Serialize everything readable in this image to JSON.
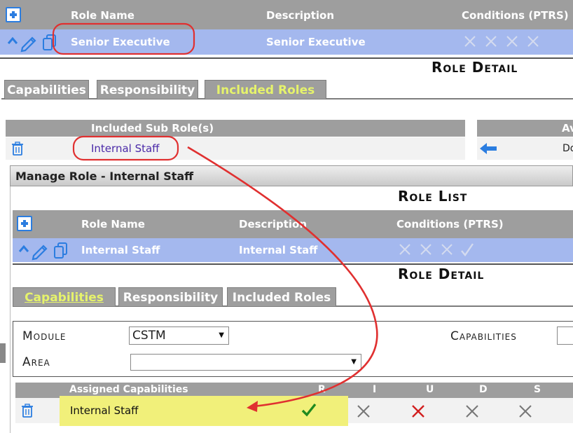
{
  "outer": {
    "role_list_header": {
      "role_name": "Role Name",
      "description": "Description",
      "conditions": "Conditions (PTRS)"
    },
    "role_row": {
      "role_name": "Senior Executive",
      "description": "Senior Executive"
    },
    "role_detail_title": "Role Detail",
    "tabs": [
      {
        "label": "Capabilities"
      },
      {
        "label": "Responsibility"
      },
      {
        "label": "Included Roles"
      }
    ],
    "included_sub_roles": {
      "header": "Included Sub Role(s)",
      "item": "Internal Staff",
      "available_header": "Av",
      "available_item": "Do"
    }
  },
  "manage_panel": {
    "title": "Manage Role - Internal Staff",
    "role_list_title": "Role List",
    "role_list_header": {
      "role_name": "Role Name",
      "description": "Description",
      "conditions": "Conditions (PTRS)"
    },
    "role_row": {
      "role_name": "Internal Staff",
      "description": "Internal Staff"
    },
    "role_detail_title": "Role Detail",
    "tabs": [
      {
        "label": "Capabilities"
      },
      {
        "label": "Responsibility"
      },
      {
        "label": "Included Roles"
      }
    ],
    "form": {
      "module_label": "Module",
      "module_value": "CSTM",
      "area_label": "Area",
      "area_value": "",
      "capabilities_label": "Capabilities"
    },
    "assigned": {
      "header": "Assigned Capabilities",
      "cols": [
        "R",
        "I",
        "U",
        "D",
        "S"
      ],
      "row": {
        "name": "Internal Staff"
      }
    }
  },
  "colors": {
    "header_gray": "#9e9e9e",
    "selected_blue": "#a4b8ee",
    "active_tab_text": "#e6f36b",
    "annotation_red": "#e03030",
    "highlight_yellow": "#f1f07a",
    "check_green": "#1f8a1f",
    "x_red": "#d21f1f"
  }
}
